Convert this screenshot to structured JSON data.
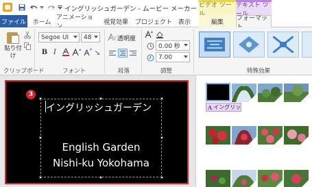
{
  "window": {
    "title": "イングリッシュガーデン - ムービー メーカー"
  },
  "context_tabs": {
    "video_tools": "ビデオ ツール",
    "text_tools": "テキスト ツール"
  },
  "tabs": {
    "file": "ファイル",
    "home": "ホーム",
    "animations": "アニメーション",
    "visual_effects": "視覚効果",
    "project": "プロジェクト",
    "view": "表示",
    "edit": "編集",
    "format": "フォーマット"
  },
  "ribbon": {
    "clipboard": {
      "paste_label": "貼り付け",
      "group_label": "クリップボード"
    },
    "font": {
      "font_name": "Segoe UI",
      "font_size": "48",
      "group_label": "フォント"
    },
    "paragraph": {
      "transparency_label": "透明度",
      "group_label": "段落"
    },
    "adjust": {
      "start_time": "0.00 秒",
      "duration": "7.00",
      "group_label": "調整"
    },
    "effects": {
      "group_label": "特殊効果"
    }
  },
  "preview": {
    "step_badge": "3",
    "caption_jp": "イングリッシュガーデン",
    "caption_en_line1": "English Garden",
    "caption_en_line2": "Nishi-ku Yokohama"
  },
  "storyboard": {
    "clip_caption": "イングリッ..."
  },
  "colors": {
    "file_tab": "#2a5ea8",
    "highlight_border": "#d5252b",
    "text_tools_accent": "#b785e0",
    "video_tools_accent": "#e8d650"
  }
}
